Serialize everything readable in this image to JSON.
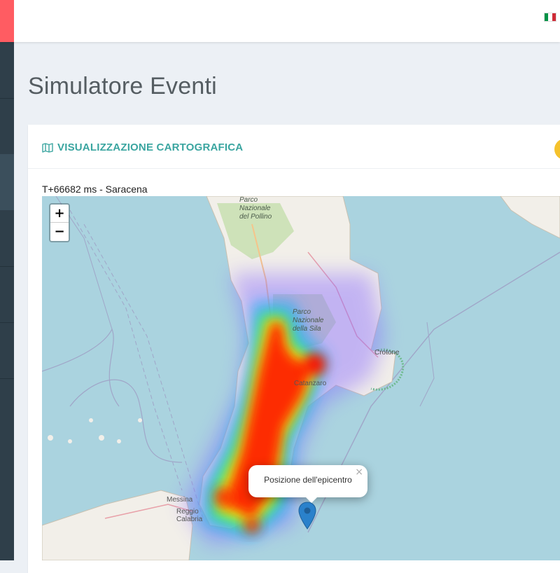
{
  "header": {
    "language_flag": "italian-flag-icon",
    "flag_colors": [
      "#009246",
      "#ffffff",
      "#ce2b37"
    ],
    "accent_color": "#ff5c62"
  },
  "page": {
    "title": "Simulatore Eventi"
  },
  "card": {
    "title": "VISUALIZZAZIONE CARTOGRAFICA",
    "title_icon": "map-icon",
    "title_color": "#3aa5a0",
    "status": "T+66682 ms - Saracena"
  },
  "map": {
    "zoom_in_label": "+",
    "zoom_out_label": "−",
    "labels": {
      "pollino": [
        "Parco",
        "Nazionale",
        "del Pollino"
      ],
      "sila": [
        "Parco",
        "Nazionale",
        "della Sila"
      ],
      "crotone": "Crotone",
      "catanzaro": "Catanzaro",
      "messina": "Messina",
      "reggio": [
        "Reggio",
        "Calabria"
      ]
    },
    "popup": {
      "text": "Posizione dell'epicentro",
      "close_label": "×"
    },
    "marker_icon": "location-pin-icon",
    "heatmap_colors": [
      "#ff0000",
      "#ffff00",
      "#00ff66",
      "#3399ff",
      "#8866ff"
    ]
  }
}
